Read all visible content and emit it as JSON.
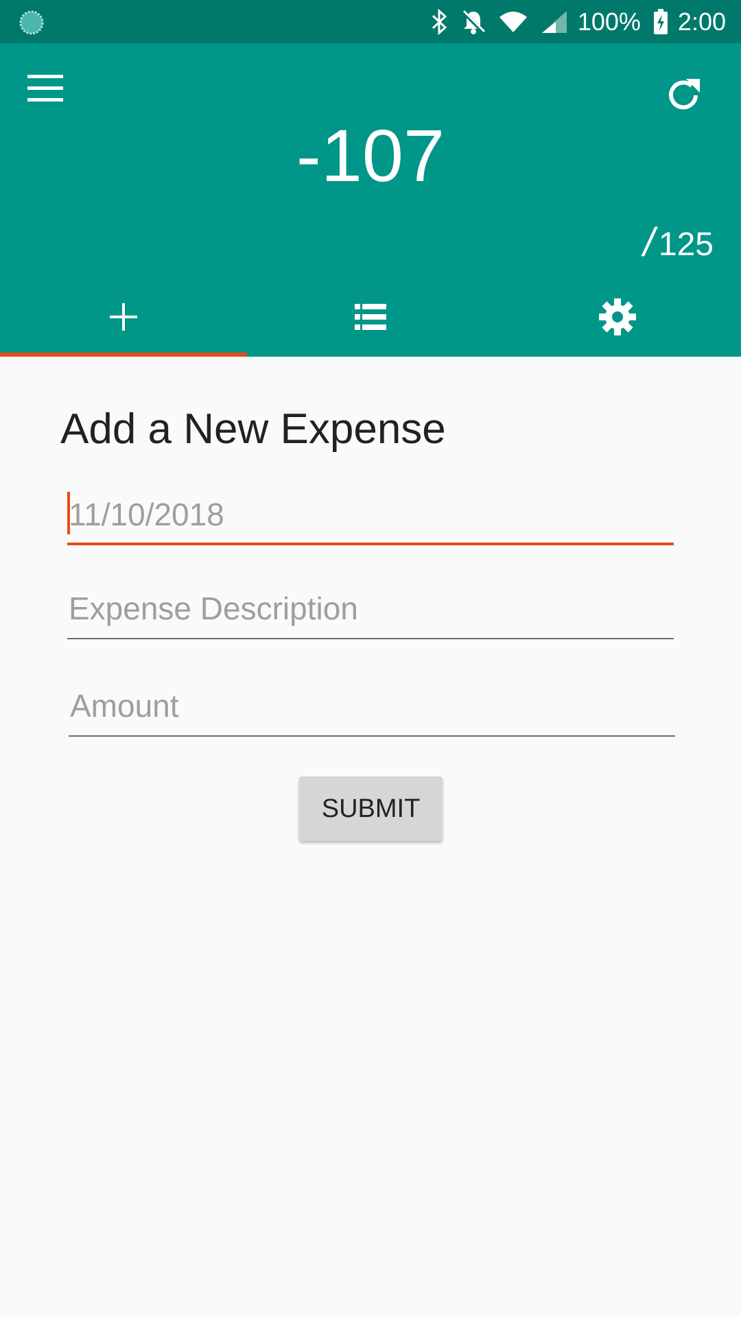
{
  "status_bar": {
    "battery_percent": "100%",
    "time": "2:00",
    "icons": [
      "loading-icon",
      "bluetooth-icon",
      "notifications-off-icon",
      "wifi-icon",
      "cell-signal-icon",
      "battery-charging-icon"
    ]
  },
  "app_bar": {
    "balance": "-107",
    "budget_slash": "/",
    "budget_total": "125",
    "menu_icon": "menu-icon",
    "refresh_icon": "refresh-icon",
    "colors": {
      "primary": "#009688",
      "primary_dark": "#00796b",
      "accent": "#e64a19"
    }
  },
  "tabs": [
    {
      "icon": "add-icon",
      "active": true
    },
    {
      "icon": "list-icon",
      "active": false
    },
    {
      "icon": "settings-icon",
      "active": false
    }
  ],
  "form": {
    "title": "Add a New Expense",
    "date_placeholder": "11/10/2018",
    "description_placeholder": "Expense Description",
    "amount_placeholder": "Amount",
    "submit_label": "SUBMIT"
  }
}
